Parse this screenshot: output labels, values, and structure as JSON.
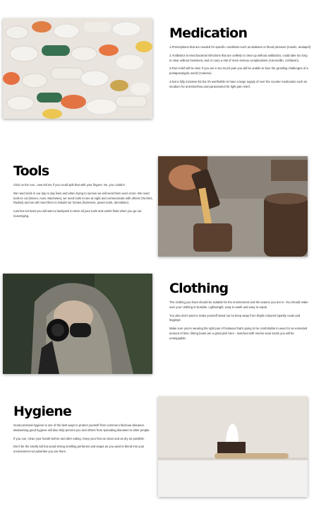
{
  "sections": {
    "medication": {
      "title": "Medication",
      "paragraphs": [
        "1.Prescriptions that are needed for specific conditions such as diabetes or blood pressure (Insulin, analapril)",
        "2.Antibiotics to treat bacterial infections that are unlikely to clear up without antibiotics, could take too long to clear without treatment, and or carry a risk of more serious complications (Amoxicillin, Cefalexin)",
        "3.Pain relief will be vital. If you are in too much pain you will be unable to face the gruelling challenges of a postapocalyptic world (Codeine)",
        "4.Not a fully inclusive list but it's worthwhile to have a large supply of over the counter medication such as imodium for anti-Diarrhea and paracetamol for light pain relief."
      ]
    },
    "tools": {
      "title": "Tools",
      "paragraphs": [
        "Click on the Axe...now tell me if you could split that with your fingers. No, you couldn't.",
        "We need tools in our day to day lives and when trying to survive we will need them even more. We need tools to cut (knives, Axes, Machetes), we need tools to see at night and communicate with others (Torches, Radios) and we will need them to rebuild our homes (hammers, power tools, demolition).",
        "Last but not least you will want a backpack to store all your tools and useful finds when you go out scavenging."
      ]
    },
    "clothing": {
      "title": "Clothing",
      "paragraphs": [
        "The clothing you have should be suitable for the environment and the season you are in. You should make sure your clothing is Durable, Lightweight, easy to wash and easy to repair.",
        "You also don't want to make yourself stand out so keep away from bright coloured sparkly coats and leggings.",
        "Make sure you're wearing the right pair of footwear that's going to be comfortable to wear for an extended amount of time, hiking boots are a great pick here - matched with merino wool socks you will be unstoppable."
      ]
    },
    "hygiene": {
      "title": "Hygiene",
      "paragraphs": [
        "Good personal hygiene is one of the best ways to protect yourself from common infectious diseases. Maintaining good hygiene will also help prevent you and others from spreading diseases to other people.",
        "If you can, clean your hands before and after eating. Keep your feet as clean and as dry as possible.",
        "Don't be the smelly kid but avoid strong smelling perfumes and soaps as you want to blend into your environment not advertise you are there."
      ]
    }
  }
}
